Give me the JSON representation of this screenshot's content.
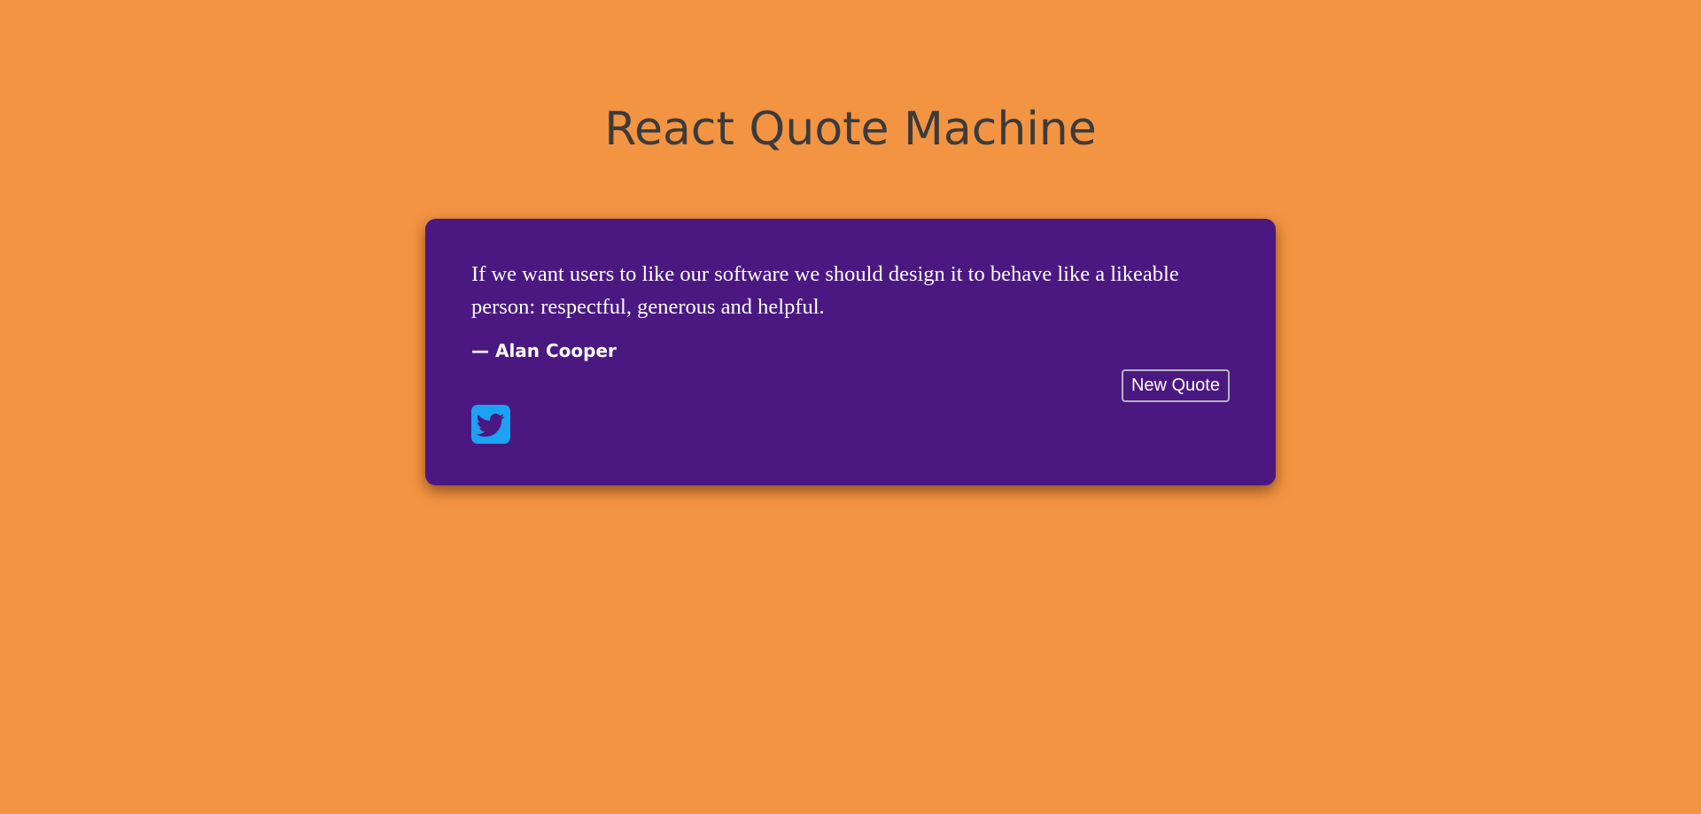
{
  "page": {
    "title": "React Quote Machine",
    "background_color": "#f39442"
  },
  "quote_card": {
    "background_color": "#4b1882",
    "text": "If we want users to like our software we should design it to behave like a likeable person: respectful, generous and helpful.",
    "author": "— Alan Cooper",
    "new_quote_label": "New Quote",
    "tweet_icon": "twitter-icon",
    "tweet_icon_color": "#1da1f2"
  }
}
